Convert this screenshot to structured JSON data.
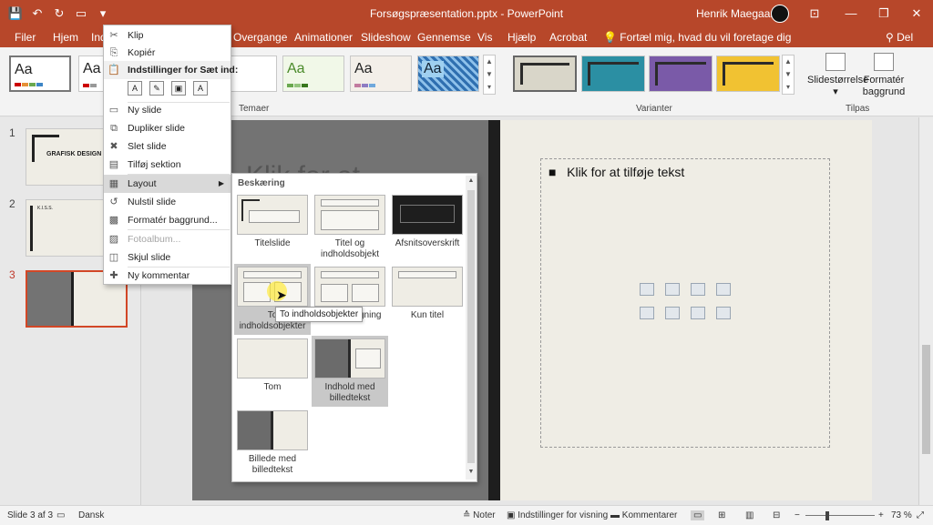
{
  "titlebar": {
    "doc_title": "Forsøgspræsentation.pptx  -  PowerPoint",
    "user": "Henrik Maegaard",
    "qat": {
      "save": "💾",
      "undo": "↶",
      "redo": "↻",
      "present": "▭",
      "more": "▾"
    },
    "controls": {
      "ribbon_display": "⊡",
      "minimize": "—",
      "restore": "❐",
      "close": "✕"
    }
  },
  "tabs": [
    "Filer",
    "Hjem",
    "Ind",
    "Overgange",
    "Animationer",
    "Slideshow",
    "Gennemse",
    "Vis",
    "Hjælp",
    "Acrobat"
  ],
  "tellme": "Fortæl mig, hvad du vil foretage dig",
  "share": "Del",
  "ribbon": {
    "themes_aa": [
      "Aa",
      "Aa",
      "a",
      "Aa",
      "Aa",
      "Aa"
    ],
    "group_temaer": "Temaer",
    "group_varianter": "Varianter",
    "group_tilpas": "Tilpas",
    "slide_size": "Slidestørrelse",
    "format_bg": "Formatér baggrund",
    "variant_colors": [
      "#d9d6c9",
      "#2b8fa3",
      "#7a5aa8",
      "#f1c232"
    ]
  },
  "thumbnails": {
    "numbers": [
      "1",
      "2",
      "3"
    ],
    "slide1_title": "GRAFISK DESIGN",
    "slide2_title": "K.I.S.S."
  },
  "slide": {
    "title_partial": "Klik for at",
    "bullet": "Klik for at tilføje tekst"
  },
  "context_menu": {
    "items": [
      {
        "icon": "✂",
        "label": "Klip"
      },
      {
        "icon": "⎘",
        "label": "Kopiér"
      },
      {
        "icon": "📋",
        "label": "Indstillinger for Sæt ind:"
      },
      {
        "icon": "▭",
        "label": "Ny slide"
      },
      {
        "icon": "⧉",
        "label": "Dupliker slide"
      },
      {
        "icon": "✖",
        "label": "Slet slide"
      },
      {
        "icon": "▤",
        "label": "Tilføj sektion"
      },
      {
        "icon": "▦",
        "label": "Layout"
      },
      {
        "icon": "↺",
        "label": "Nulstil slide"
      },
      {
        "icon": "▩",
        "label": "Formatér baggrund..."
      },
      {
        "icon": "▨",
        "label": "Fotoalbum..."
      },
      {
        "icon": "◫",
        "label": "Skjul slide"
      },
      {
        "icon": "✚",
        "label": "Ny kommentar"
      }
    ],
    "paste_icons": [
      "A",
      "✎",
      "▣",
      "A"
    ]
  },
  "layout_gallery": {
    "header": "Beskæring",
    "layouts": [
      "Titelslide",
      "Titel og indholdsobjekt",
      "Afsnitsoverskrift",
      "To indholdsobjekter",
      "Sammenligning",
      "Kun titel",
      "Tom",
      "Indhold med billedtekst",
      "Billede med billedtekst"
    ],
    "tooltip": "To indholdsobjekter"
  },
  "statusbar": {
    "slide_info": "Slide 3 af 3",
    "language": "Dansk",
    "notes": "Noter",
    "display_settings": "Indstillinger for visning",
    "comments": "Kommentarer",
    "zoom": "73 %"
  }
}
